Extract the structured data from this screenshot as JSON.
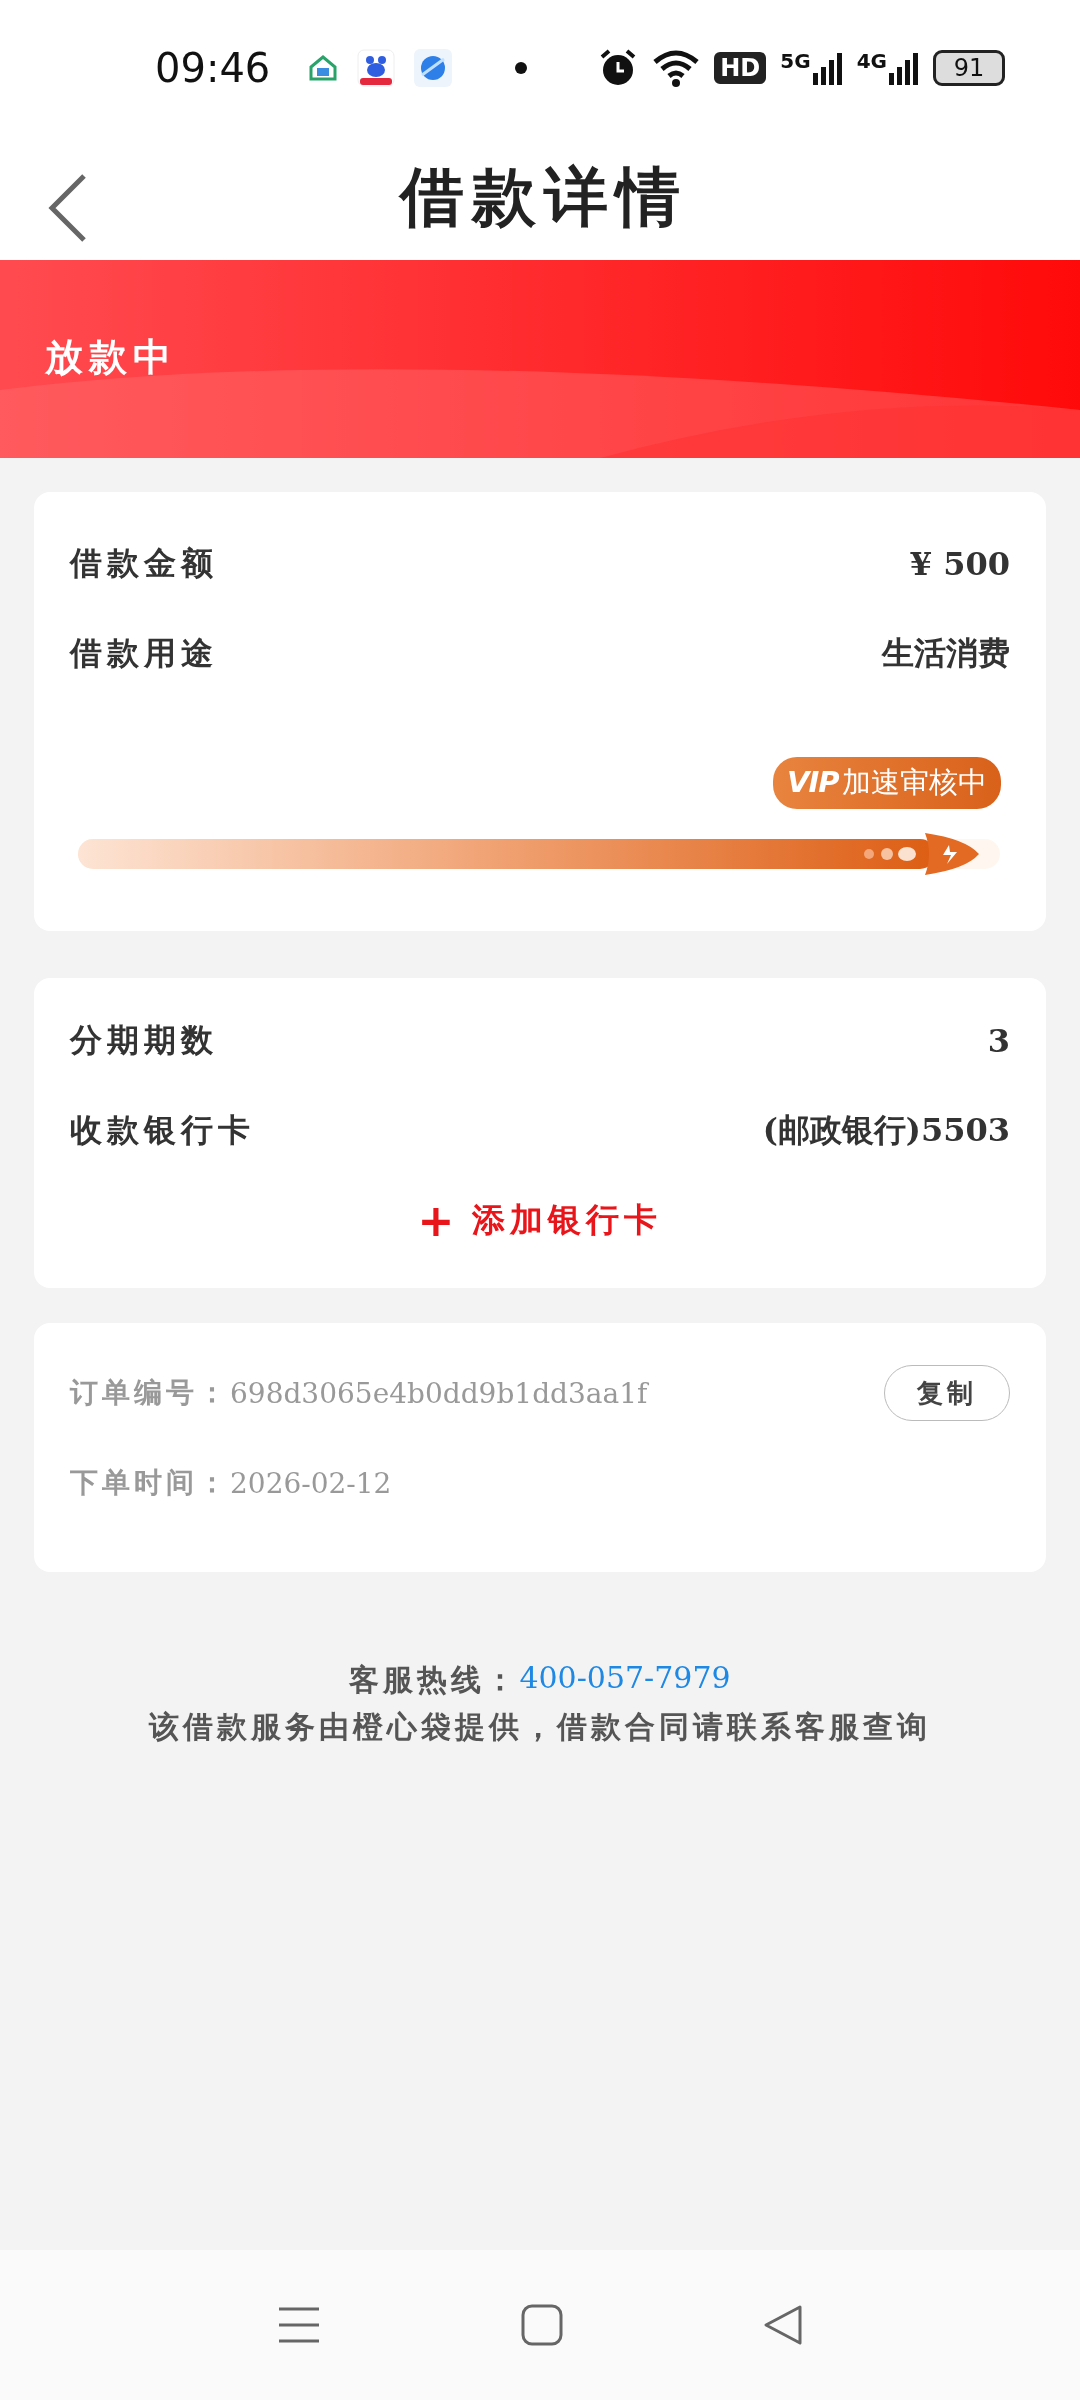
{
  "status_bar": {
    "time": "09:46",
    "hd": "HD",
    "network_1": "5G",
    "network_2": "4G",
    "battery": "91"
  },
  "header": {
    "title": "借款详情"
  },
  "banner": {
    "status": "放款中"
  },
  "loan_card": {
    "rows": [
      {
        "label": "借款金额",
        "value": "¥ 500"
      },
      {
        "label": "借款用途",
        "value": "生活消费"
      }
    ],
    "progress": {
      "level": 0.93,
      "tooltip_badge": "VIP",
      "tooltip": "加速审核中"
    }
  },
  "repay_card": {
    "rows": [
      {
        "label": "分期期数",
        "value": "3"
      },
      {
        "label": "收款银行卡",
        "value": "(邮政银行)5503"
      }
    ],
    "add_button": {
      "icon": "+",
      "label": "添加银行卡"
    }
  },
  "order_card": {
    "fields": [
      {
        "label": "订单编号：",
        "value": "698d3065e4b0dd9b1dd3aa1f"
      },
      {
        "label": "下单时间：",
        "value": "2026-02-12"
      }
    ],
    "copy_button": "复制"
  },
  "footer": {
    "hotline_label": "客服热线：",
    "hotline": "400-057-7979",
    "note": "该借款服务由橙心袋提供，借款合同请联系客服查询"
  }
}
